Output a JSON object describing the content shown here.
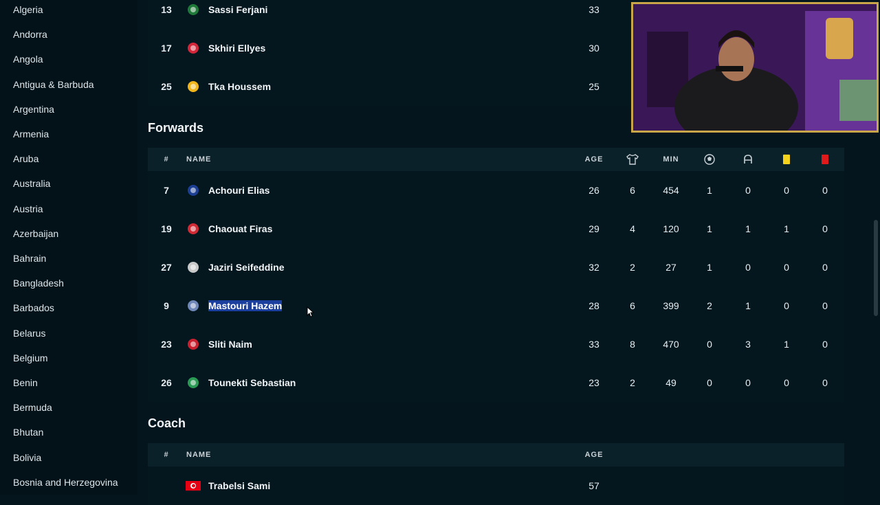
{
  "sidebar": {
    "countries": [
      "Algeria",
      "Andorra",
      "Angola",
      "Antigua & Barbuda",
      "Argentina",
      "Armenia",
      "Aruba",
      "Australia",
      "Austria",
      "Azerbaijan",
      "Bahrain",
      "Bangladesh",
      "Barbados",
      "Belarus",
      "Belgium",
      "Benin",
      "Bermuda",
      "Bhutan",
      "Bolivia",
      "Bosnia and Herzegovina"
    ]
  },
  "top_rows": [
    {
      "num": "13",
      "name": "Sassi Ferjani",
      "age": "33",
      "crest_color": "#1f7a3a"
    },
    {
      "num": "17",
      "name": "Skhiri Ellyes",
      "age": "30",
      "crest_color": "#d2273a"
    },
    {
      "num": "25",
      "name": "Tka Houssem",
      "age": "25",
      "crest_color": "#f2b51c"
    }
  ],
  "forwards": {
    "title": "Forwards",
    "headers": {
      "num": "#",
      "name": "NAME",
      "age": "AGE",
      "apps_icon": "shirt-icon",
      "min": "MIN",
      "goals_icon": "ball-icon",
      "assists_icon": "assist-icon",
      "yellow_icon": "yellow-card-icon",
      "red_icon": "red-card-icon"
    },
    "rows": [
      {
        "num": "7",
        "name": "Achouri Elias",
        "age": "26",
        "apps": "6",
        "min": "454",
        "goals": "1",
        "assists": "0",
        "yellow": "0",
        "red": "0",
        "crest_color": "#1c3f94"
      },
      {
        "num": "19",
        "name": "Chaouat Firas",
        "age": "29",
        "apps": "4",
        "min": "120",
        "goals": "1",
        "assists": "1",
        "yellow": "1",
        "red": "0",
        "crest_color": "#d02a35"
      },
      {
        "num": "27",
        "name": "Jaziri Seifeddine",
        "age": "32",
        "apps": "2",
        "min": "27",
        "goals": "1",
        "assists": "0",
        "yellow": "0",
        "red": "0",
        "crest_color": "#c9c9c9"
      },
      {
        "num": "9",
        "name": "Mastouri Hazem",
        "age": "28",
        "apps": "6",
        "min": "399",
        "goals": "2",
        "assists": "1",
        "yellow": "0",
        "red": "0",
        "crest_color": "#6f88b8",
        "selected": true
      },
      {
        "num": "23",
        "name": "Sliti Naim",
        "age": "33",
        "apps": "8",
        "min": "470",
        "goals": "0",
        "assists": "3",
        "yellow": "1",
        "red": "0",
        "crest_color": "#c8202e"
      },
      {
        "num": "26",
        "name": "Tounekti Sebastian",
        "age": "23",
        "apps": "2",
        "min": "49",
        "goals": "0",
        "assists": "0",
        "yellow": "0",
        "red": "0",
        "crest_color": "#2a9a55"
      }
    ]
  },
  "coach": {
    "title": "Coach",
    "headers": {
      "num": "#",
      "name": "NAME",
      "age": "AGE"
    },
    "rows": [
      {
        "num": "",
        "name": "Trabelsi Sami",
        "age": "57",
        "flag_color": "#e70013"
      }
    ]
  },
  "colors": {
    "background": "#04151d",
    "header_bg": "#0b2129",
    "yellow_card": "#f5d21b",
    "red_card": "#e01a1a",
    "selection": "#1b3f9e",
    "webcam_border": "#c9a64a"
  }
}
